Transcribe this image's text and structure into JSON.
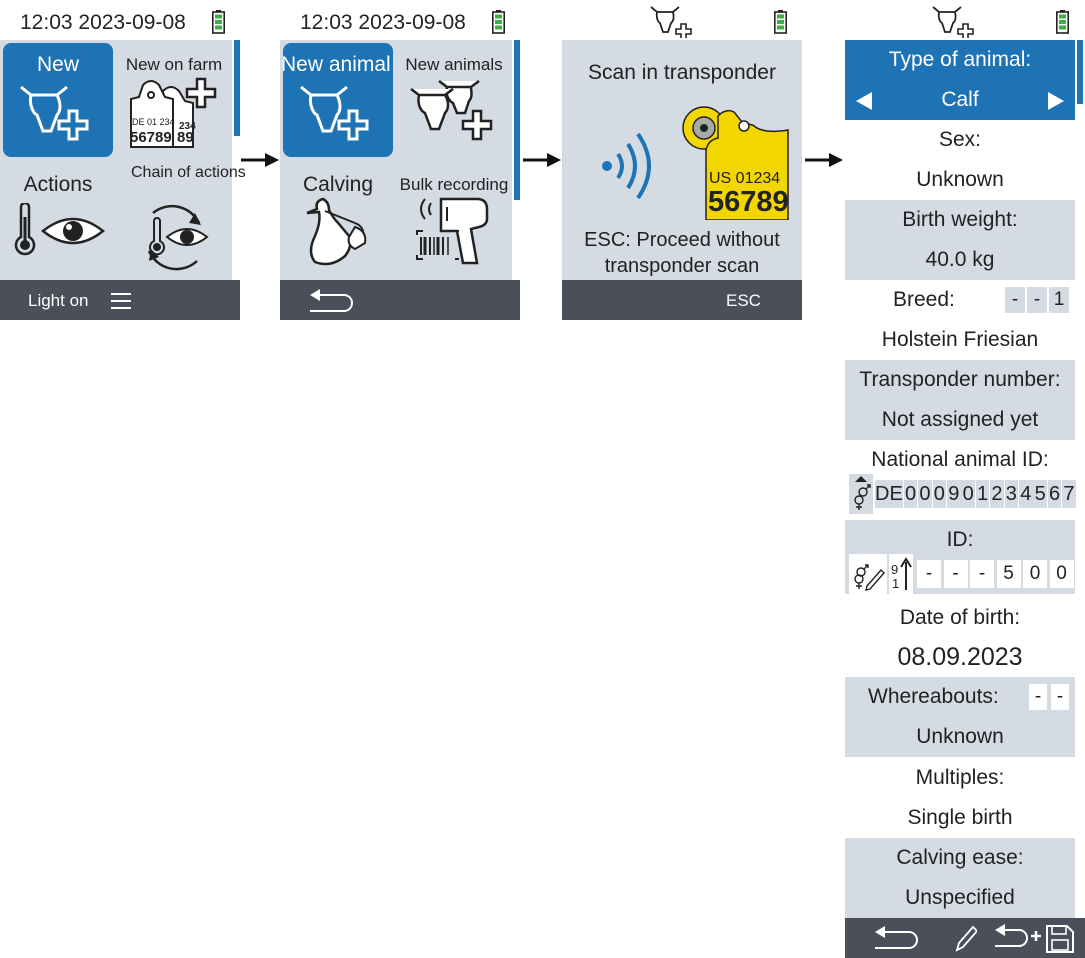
{
  "screen1": {
    "status_time": "12:03 2023-09-08",
    "tiles": [
      {
        "label": "New",
        "icon": "cow-plus-icon",
        "selected": true
      },
      {
        "label": "New on farm",
        "icon": "ear-tags-plus-icon",
        "tag_top": "DE 01 234",
        "tag_number": "56789",
        "tag_back_top": "234",
        "tag_back_number": "89"
      },
      {
        "label": "Actions",
        "icon": "thermometer-eye-icon"
      },
      {
        "label": "Chain of actions",
        "icon": "cycle-thermometer-eye-icon"
      }
    ],
    "footer_label": "Light on",
    "footer_icon": "menu-icon"
  },
  "screen2": {
    "status_time": "12:03 2023-09-08",
    "tiles": [
      {
        "label": "New animal",
        "icon": "cow-plus-icon",
        "selected": true
      },
      {
        "label": "New animals",
        "icon": "cows-plus-icon"
      },
      {
        "label": "Calving",
        "icon": "stork-icon"
      },
      {
        "label": "Bulk recording",
        "icon": "barcode-scanner-icon"
      }
    ],
    "footer_icon": "back-icon"
  },
  "screen3": {
    "header_icon": "cow-plus-icon",
    "title": "Scan in transponder",
    "tag_number_top": "US 01234",
    "tag_number_big": "56789",
    "message": "ESC: Proceed without transponder scan",
    "footer_label": "ESC"
  },
  "screen4": {
    "header_icon": "cow-plus-icon",
    "type_label": "Type of animal:",
    "type_value": "Calf",
    "sex_label": "Sex:",
    "sex_value": "Unknown",
    "birth_weight_label": "Birth weight:",
    "birth_weight_value": "40.0 kg",
    "breed_label": "Breed:",
    "breed_cells": [
      "-",
      "-",
      "1"
    ],
    "breed_value": "Holstein Friesian",
    "transponder_label": "Transponder number:",
    "transponder_value": "Not assigned yet",
    "national_id_label": "National animal ID:",
    "national_id_cells": [
      "D",
      "E",
      "0",
      "0",
      "0",
      "9",
      "0",
      "1",
      "2",
      "3",
      "4",
      "5",
      "6",
      "7"
    ],
    "id_label": "ID:",
    "id_cells": [
      "-",
      "-",
      "-",
      "5",
      "0",
      "0"
    ],
    "dob_label": "Date of birth:",
    "dob_value": "08.09.2023",
    "whereabouts_label": "Whereabouts:",
    "whereabouts_cells": [
      "-",
      "-"
    ],
    "whereabouts_value": "Unknown",
    "multiples_label": "Multiples:",
    "multiples_value": "Single birth",
    "calving_ease_label": "Calving ease:",
    "calving_ease_value": "Unspecified",
    "footer_icons": [
      "back-icon",
      "edit-icon",
      "back-plus-save-icon"
    ]
  },
  "colors": {
    "accent": "#1e73b5",
    "screen_bg": "#d5dbe3",
    "footer": "#4a4f5a",
    "battery": "#3cb043",
    "tag_yellow": "#f2d600"
  }
}
